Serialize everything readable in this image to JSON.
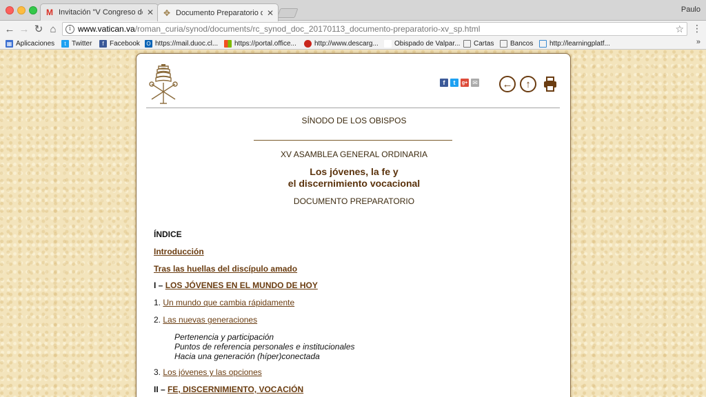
{
  "browser": {
    "tabs": [
      {
        "title": "Invitación \"V Congreso de jóve",
        "icon": "gmail-icon",
        "active": false
      },
      {
        "title": "Documento Preparatorio de la",
        "icon": "vatican-icon",
        "active": true
      }
    ],
    "profile_name": "Paulo",
    "url_domain": "www.vatican.va",
    "url_path": "/roman_curia/synod/documents/rc_synod_doc_20170113_documento-preparatorio-xv_sp.html",
    "bookmarks": [
      {
        "label": "Aplicaciones",
        "icon": "apps-grid-icon",
        "color": "#3b6fd1"
      },
      {
        "label": "Twitter",
        "icon": "twitter-icon",
        "color": "#1da1f2"
      },
      {
        "label": "Facebook",
        "icon": "facebook-icon",
        "color": "#3b5998"
      },
      {
        "label": "https://mail.duoc.cl...",
        "icon": "outlook-icon",
        "color": "#0a64b6"
      },
      {
        "label": "https://portal.office...",
        "icon": "office-icon",
        "color": "#eb3c00"
      },
      {
        "label": "http://www.descarg...",
        "icon": "tomato-icon",
        "color": "#c9261c"
      },
      {
        "label": "Obispado de Valpar...",
        "icon": "page-icon",
        "color": "#ffffff"
      },
      {
        "label": "Cartas",
        "icon": "folder-icon",
        "color": "#8a8a8a"
      },
      {
        "label": "Bancos",
        "icon": "folder-icon",
        "color": "#8a8a8a"
      },
      {
        "label": "http://learningplatf...",
        "icon": "page-icon",
        "color": "#3b8bd1"
      }
    ],
    "more_bookmarks": "»"
  },
  "page": {
    "header": {
      "social": [
        "f",
        "t",
        "g+",
        "✉"
      ],
      "nav_icons": [
        "back-arrow-icon",
        "up-arrow-icon",
        "print-icon"
      ]
    },
    "synod": "SÍNODO DE LOS OBISPOS",
    "asamblea": "XV ASAMBLEA GENERAL ORDINARIA",
    "title_line1": "Los jóvenes, la fe y",
    "title_line2": "el discernimiento vocacional",
    "doc_type": "DOCUMENTO PREPARATORIO",
    "toc": {
      "heading": "ÍNDICE",
      "intro": "Introducción",
      "tras": "Tras las huellas del discípulo amado",
      "section1_prefix": "I – ",
      "section1": "LOS JÓVENES EN EL MUNDO DE HOY",
      "item1_num": "1. ",
      "item1": "Un mundo que cambia rápidamente",
      "item2_num": "2. ",
      "item2": "Las nuevas generaciones",
      "sub1": "Pertenencia y participación",
      "sub2": "Puntos de referencia personales e institucionales",
      "sub3": "Hacia una generación (híper)conectada",
      "item3_num": "3. ",
      "item3": "Los jóvenes y las opciones",
      "section2_prefix": "II – ",
      "section2": "FE, DISCERNIMIENTO, VOCACIÓN"
    }
  }
}
